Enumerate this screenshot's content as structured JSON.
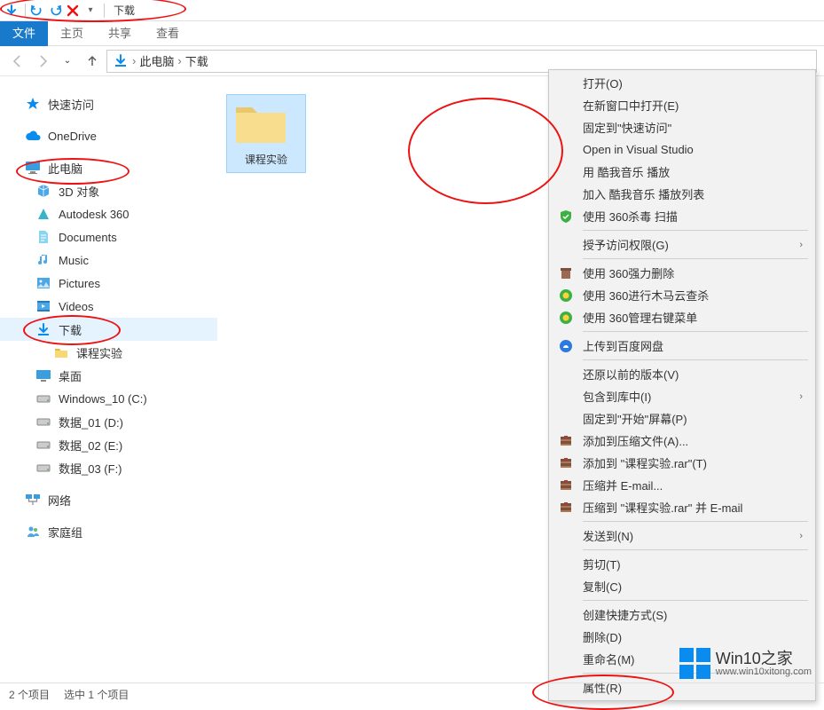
{
  "title_bar": {
    "title": "下载"
  },
  "ribbon": {
    "tabs": [
      "文件",
      "主页",
      "共享",
      "查看"
    ],
    "active_index": 0
  },
  "breadcrumb": {
    "items": [
      "此电脑",
      "下载"
    ]
  },
  "sidebar": {
    "quick_access": "快速访问",
    "onedrive": "OneDrive",
    "this_pc": "此电脑",
    "folders": [
      "3D 对象",
      "Autodesk 360",
      "Documents",
      "Music",
      "Pictures",
      "Videos",
      "下载"
    ],
    "downloads_children": [
      "课程实验"
    ],
    "desktop": "桌面",
    "drives": [
      "Windows_10 (C:)",
      "数据_01 (D:)",
      "数据_02 (E:)",
      "数据_03 (F:)"
    ],
    "network": "网络",
    "homegroup": "家庭组"
  },
  "content": {
    "selected_folder": "课程实验"
  },
  "context_menu": {
    "groups": [
      [
        {
          "label": "打开(O)",
          "icon": ""
        },
        {
          "label": "在新窗口中打开(E)",
          "icon": ""
        },
        {
          "label": "固定到\"快速访问\"",
          "icon": ""
        },
        {
          "label": "Open in Visual Studio",
          "icon": ""
        },
        {
          "label": "用 酷我音乐 播放",
          "icon": ""
        },
        {
          "label": "加入 酷我音乐 播放列表",
          "icon": ""
        },
        {
          "label": "使用 360杀毒 扫描",
          "icon": "shield"
        }
      ],
      [
        {
          "label": "授予访问权限(G)",
          "icon": "",
          "arrow": true
        }
      ],
      [
        {
          "label": "使用 360强力删除",
          "icon": "del"
        },
        {
          "label": "使用 360进行木马云查杀",
          "icon": "360y"
        },
        {
          "label": "使用 360管理右键菜单",
          "icon": "360y"
        }
      ],
      [
        {
          "label": "上传到百度网盘",
          "icon": "baidu"
        }
      ],
      [
        {
          "label": "还原以前的版本(V)",
          "icon": ""
        },
        {
          "label": "包含到库中(I)",
          "icon": "",
          "arrow": true
        },
        {
          "label": "固定到\"开始\"屏幕(P)",
          "icon": ""
        },
        {
          "label": "添加到压缩文件(A)...",
          "icon": "rar"
        },
        {
          "label": "添加到 \"课程实验.rar\"(T)",
          "icon": "rar"
        },
        {
          "label": "压缩并 E-mail...",
          "icon": "rar"
        },
        {
          "label": "压缩到 \"课程实验.rar\" 并 E-mail",
          "icon": "rar"
        }
      ],
      [
        {
          "label": "发送到(N)",
          "icon": "",
          "arrow": true
        }
      ],
      [
        {
          "label": "剪切(T)",
          "icon": ""
        },
        {
          "label": "复制(C)",
          "icon": ""
        }
      ],
      [
        {
          "label": "创建快捷方式(S)",
          "icon": ""
        },
        {
          "label": "删除(D)",
          "icon": ""
        },
        {
          "label": "重命名(M)",
          "icon": ""
        }
      ],
      [
        {
          "label": "属性(R)",
          "icon": ""
        }
      ]
    ]
  },
  "status_bar": {
    "items_count": "2 个项目",
    "selected": "选中 1 个项目"
  },
  "watermark": {
    "title": "Win10之家",
    "site": "www.win10xitong.com"
  }
}
